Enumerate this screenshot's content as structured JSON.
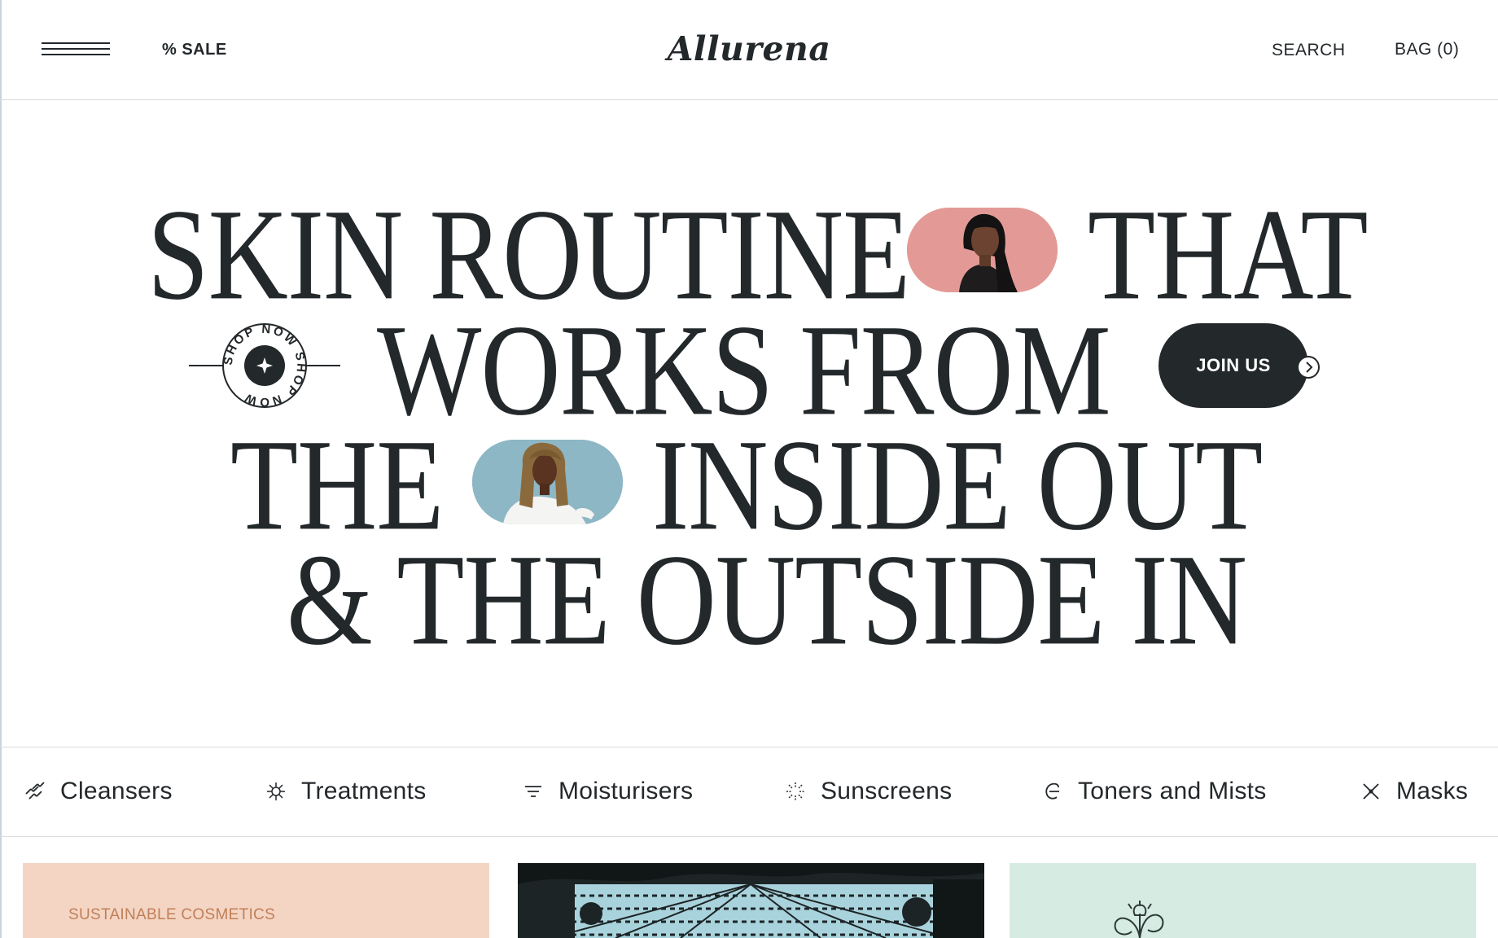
{
  "header": {
    "sale_label": "% SALE",
    "logo": "Allurena",
    "search_label": "SEARCH",
    "bag_label": "BAG (0)"
  },
  "hero": {
    "line1_a": "SKIN ROUTINE",
    "line1_b": "THAT",
    "line2": "WORKS FROM",
    "line3_a": "THE",
    "line3_b": "INSIDE OUT",
    "line4": "& THE OUTSIDE IN",
    "badge_text": "SHOP NOW SHOP NOW",
    "join_label": "JOIN US"
  },
  "categories": [
    {
      "label": "Cleansers",
      "icon": "waves-icon"
    },
    {
      "label": "Treatments",
      "icon": "sparkle-icon"
    },
    {
      "label": "Moisturisers",
      "icon": "filter-lines-icon"
    },
    {
      "label": "Sunscreens",
      "icon": "sunburst-icon"
    },
    {
      "label": "Toners and Mists",
      "icon": "swirl-icon"
    },
    {
      "label": "Masks",
      "icon": "cross-star-icon"
    }
  ],
  "cards": [
    {
      "label": "SUSTAINABLE COSMETICS",
      "color": "#f4d5c4"
    },
    {
      "label": "",
      "color": "#a9d3dc"
    },
    {
      "label": "",
      "color": "#d6ebe2"
    }
  ],
  "colors": {
    "text": "#23282b",
    "accent_peach": "#c07f58",
    "photo_pink": "#e39a96",
    "photo_blue": "#8db7c4"
  }
}
